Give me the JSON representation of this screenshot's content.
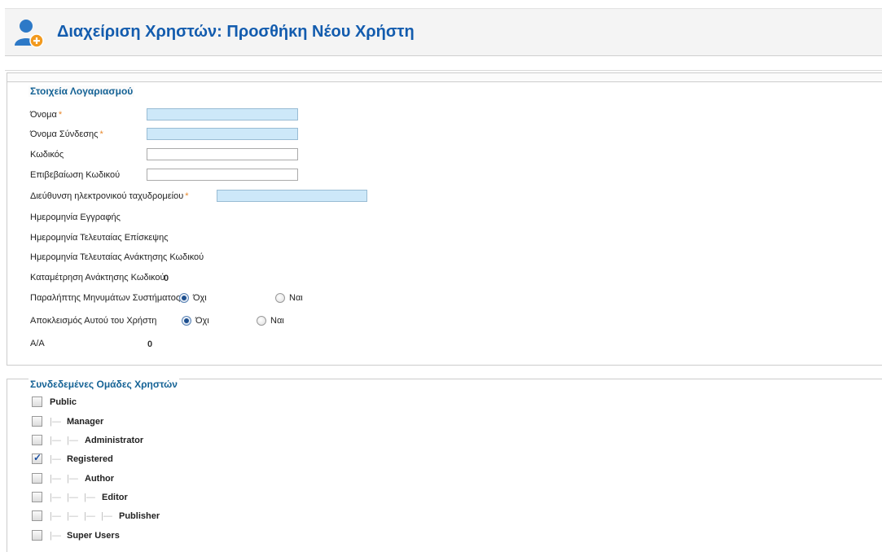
{
  "header": {
    "title": "Διαχείριση Χρηστών: Προσθήκη Νέου Χρήστη",
    "icon": "user-add-icon"
  },
  "account": {
    "legend": "Στοιχεία Λογαριασμού",
    "name_label": "Όνομα",
    "username_label": "Όνομα Σύνδεσης",
    "password_label": "Κωδικός",
    "password2_label": "Επιβεβαίωση Κωδικού",
    "email_label": "Διεύθυνση ηλεκτρονικού ταχυδρομείου",
    "required_mark": "*",
    "register_date_label": "Ημερομηνία Εγγραφής",
    "last_visit_label": "Ημερομηνία Τελευταίας Επίσκεψης",
    "last_reset_label": "Ημερομηνία Τελευταίας Ανάκτησης Κωδικού",
    "reset_count_label": "Καταμέτρηση Ανάκτησης Κωδικού",
    "reset_count_value": "0",
    "send_email_label": "Παραλήπτης Μηνυμάτων Συστήματος",
    "block_label": "Αποκλεισμός Αυτού του Χρήστη",
    "no_label": "Όχι",
    "yes_label": "Ναι",
    "id_label": "Α/Α",
    "id_value": "0"
  },
  "groups": {
    "legend": "Συνδεδεμένες Ομάδες Χρηστών",
    "tree_mark": "|—",
    "items": [
      {
        "name": "Public",
        "checked": false
      },
      {
        "name": "Manager",
        "checked": false
      },
      {
        "name": "Administrator",
        "checked": false
      },
      {
        "name": "Registered",
        "checked": true
      },
      {
        "name": "Author",
        "checked": false
      },
      {
        "name": "Editor",
        "checked": false
      },
      {
        "name": "Publisher",
        "checked": false
      },
      {
        "name": "Super Users",
        "checked": false
      }
    ]
  }
}
